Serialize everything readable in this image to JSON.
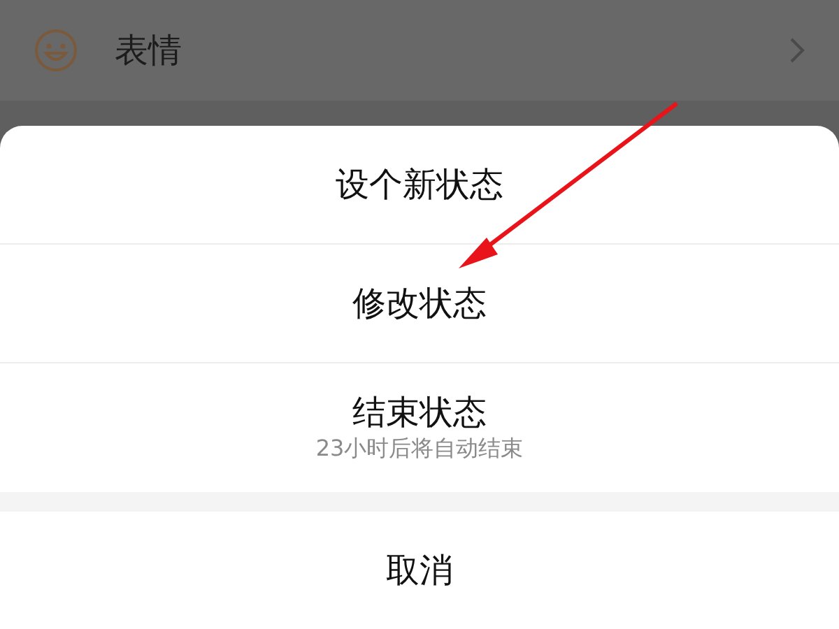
{
  "background_row": {
    "label": "表情"
  },
  "action_sheet": {
    "options": [
      {
        "label": "设个新状态"
      },
      {
        "label": "修改状态"
      },
      {
        "label": "结束状态",
        "subtitle": "23小时后将自动结束"
      }
    ],
    "cancel": "取消"
  }
}
